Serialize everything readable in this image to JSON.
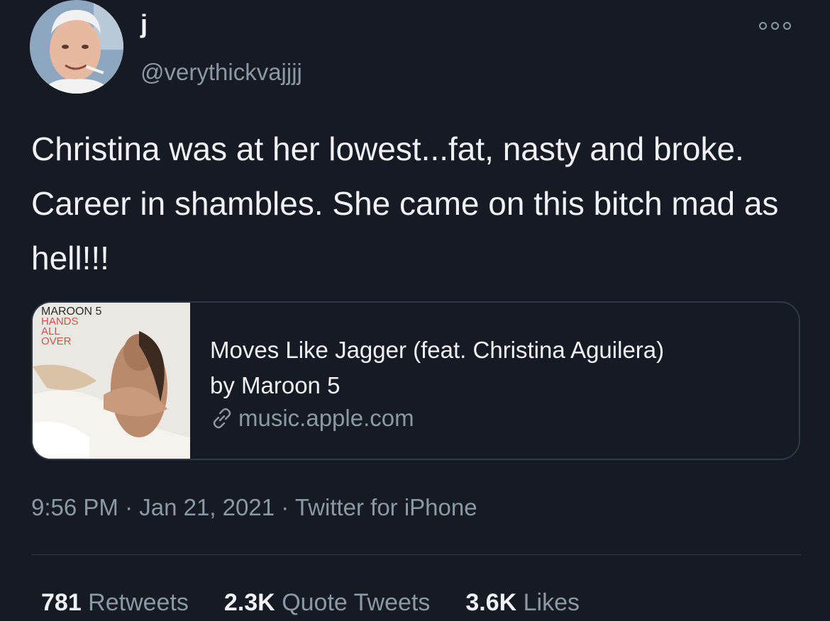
{
  "user": {
    "display_name": "j",
    "handle": "@verythickvajjjj",
    "avatar_icon": "profile-photo"
  },
  "tweet": {
    "text": "Christina was at her lowest...fat, nasty and broke. Career in shambles. She came on this bitch mad as hell!!!"
  },
  "card": {
    "album_band": "MAROON 5",
    "album_title_lines": [
      "HANDS",
      "ALL",
      "OVER"
    ],
    "title_line1": "Moves Like Jagger (feat. Christina Aguilera)",
    "title_line2": "by Maroon 5",
    "domain": "music.apple.com",
    "link_icon": "link-icon"
  },
  "meta": {
    "time": "9:56 PM",
    "separator": " · ",
    "date": "Jan 21, 2021",
    "source": "Twitter for iPhone"
  },
  "stats": {
    "retweets_count": "781",
    "retweets_label": " Retweets",
    "quotes_count": "2.3K",
    "quotes_label": " Quote Tweets",
    "likes_count": "3.6K",
    "likes_label": " Likes"
  },
  "colors": {
    "background": "#151a23",
    "text_primary": "#eef1f5",
    "text_secondary": "#8b98a5",
    "border": "#2f3945"
  }
}
